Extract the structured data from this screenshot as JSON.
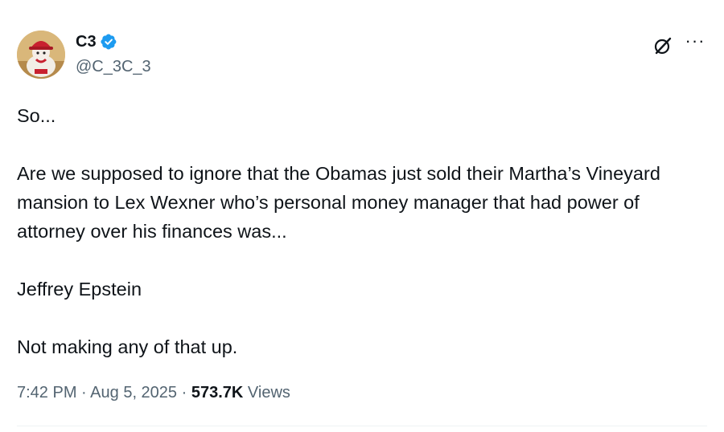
{
  "author": {
    "display_name": "C3",
    "handle": "@C_3C_3",
    "verified": true,
    "verified_color": "#1d9bf0"
  },
  "icons": {
    "grok": "grok-icon",
    "more": "more-icon",
    "verified": "verified-badge-icon",
    "avatar": "avatar-image"
  },
  "tweet": {
    "paragraphs": [
      "So...",
      "Are we supposed to ignore that the Obamas just sold their Martha’s Vineyard mansion to Lex Wexner who’s personal money manager that had power of attorney over his finances was...",
      "Jeffrey Epstein",
      "Not making any of that up."
    ]
  },
  "meta": {
    "time": "7:42 PM",
    "separator": "·",
    "date": "Aug 5, 2025",
    "views_count": "573.7K",
    "views_label": "Views"
  },
  "more_glyph": "···"
}
